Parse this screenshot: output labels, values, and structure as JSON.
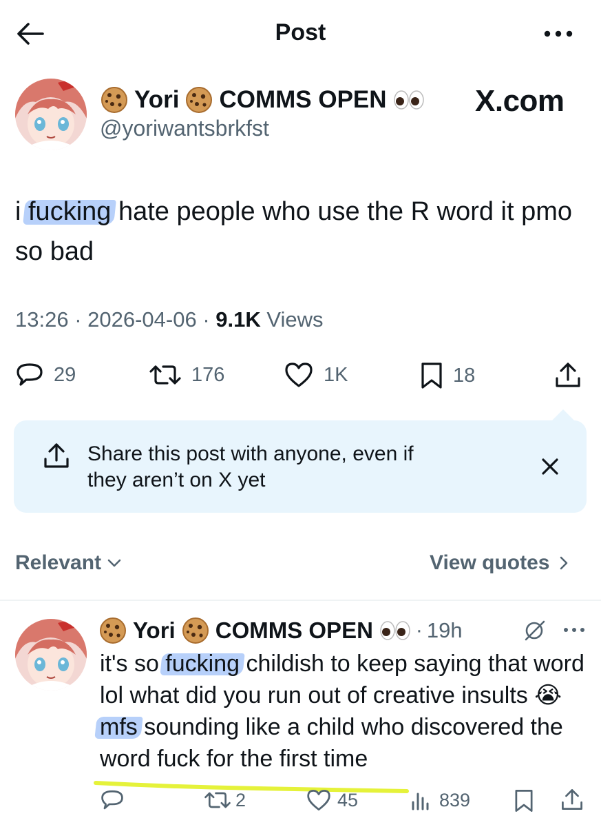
{
  "header": {
    "title": "Post"
  },
  "post": {
    "author": {
      "name": "Yori",
      "name_suffix": "COMMS OPEN",
      "handle": "@yoriwantsbrkfst"
    },
    "watermark": "X.com",
    "text_before": "i ",
    "text_highlight": "fucking",
    "text_after": " hate people who use the R word it pmo so bad",
    "time": "13:26",
    "date": "2026-04-06",
    "views_count": "9.1K",
    "views_label": "Views",
    "stats": {
      "replies": "29",
      "reposts": "176",
      "likes": "1K",
      "bookmarks": "18"
    }
  },
  "share_prompt": {
    "text_line1": "Share this post with anyone, even if",
    "text_line2": "they aren’t on X yet"
  },
  "replies_filter": {
    "sort_label": "Relevant",
    "view_quotes_label": "View quotes"
  },
  "reply": {
    "author": {
      "name": "Yori",
      "name_suffix": "COMMS OPEN"
    },
    "time": "19h",
    "text_1": "it's so ",
    "text_hl1": "fucking",
    "text_2": " childish to keep saying that word lol what did you run out of creative insults ",
    "text_emoji": "😭",
    "text_3": " ",
    "text_hl2": "mfs",
    "text_4": " sounding like a child who discovered the word fuck for the first time",
    "stats": {
      "reposts": "2",
      "likes": "45",
      "views": "839"
    }
  },
  "colors": {
    "text": "#0f1419",
    "secondary": "#536471",
    "share_bg": "#e8f5fd",
    "highlight": "#6096f5",
    "underline": "#e5f23a"
  },
  "icons": [
    "back-arrow-icon",
    "more-icon",
    "cookie-emoji-icon",
    "eyes-emoji-icon",
    "reply-icon",
    "repost-icon",
    "like-icon",
    "bookmark-icon",
    "share-icon",
    "close-icon",
    "chevron-down-icon",
    "chevron-right-icon",
    "grok-icon",
    "views-icon"
  ]
}
